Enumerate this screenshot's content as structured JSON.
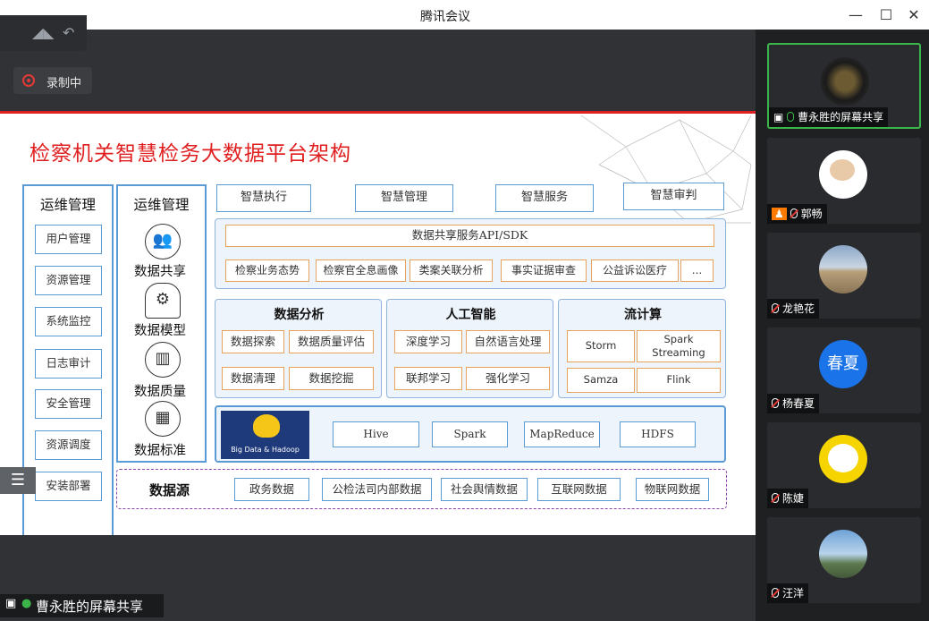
{
  "window": {
    "title": "腾讯会议",
    "minimize_icon": "—",
    "maximize_icon": "☐",
    "close_icon": "✕"
  },
  "recording": {
    "label": "录制中"
  },
  "slide": {
    "title": "检察机关智慧检务大数据平台架构",
    "ops_left": {
      "title": "运维管理",
      "items": [
        "用户管理",
        "资源管理",
        "系统监控",
        "日志审计",
        "安全管理",
        "资源调度",
        "安装部署"
      ]
    },
    "ops_mid": {
      "title": "运维管理",
      "items": [
        "数据共享",
        "数据模型",
        "数据质量",
        "数据标准"
      ]
    },
    "top_apps": [
      "智慧执行",
      "智慧管理",
      "智慧服务",
      "智慧审判"
    ],
    "service": {
      "header": "数据共享服务API/SDK",
      "items": [
        "检察业务态势",
        "检察官全息画像",
        "类案关联分析",
        "事实证据审查",
        "公益诉讼医疗",
        "..."
      ]
    },
    "analysis": {
      "title": "数据分析",
      "items": [
        "数据探索",
        "数据质量评估",
        "数据清理",
        "数据挖掘"
      ]
    },
    "ai": {
      "title": "人工智能",
      "items": [
        "深度学习",
        "自然语言处理",
        "联邦学习",
        "强化学习"
      ]
    },
    "stream": {
      "title": "流计算",
      "items": [
        "Storm",
        "Spark Streaming",
        "Samza",
        "Flink"
      ]
    },
    "bigdata": {
      "logo_text": "Big Data & Hadoop",
      "items": [
        "Hive",
        "Spark",
        "MapReduce",
        "HDFS"
      ]
    },
    "sources": {
      "label": "数据源",
      "items": [
        "政务数据",
        "公检法司内部数据",
        "社会舆情数据",
        "互联网数据",
        "物联网数据"
      ]
    }
  },
  "share_label": "曹永胜的屏幕共享",
  "participants": [
    {
      "name": "曹永胜的屏幕共享",
      "mic": "on"
    },
    {
      "name": "郭畅",
      "mic": "off"
    },
    {
      "name": "龙艳花",
      "mic": "off"
    },
    {
      "name": "杨春夏",
      "mic": "off",
      "avatar_text": "春夏"
    },
    {
      "name": "陈婕",
      "mic": "off"
    },
    {
      "name": "汪洋",
      "mic": "off"
    }
  ],
  "colors": {
    "accent_red": "#e02020",
    "blue": "#5b9bd5",
    "orange": "#e8a25c",
    "active_green": "#3bb54a"
  }
}
